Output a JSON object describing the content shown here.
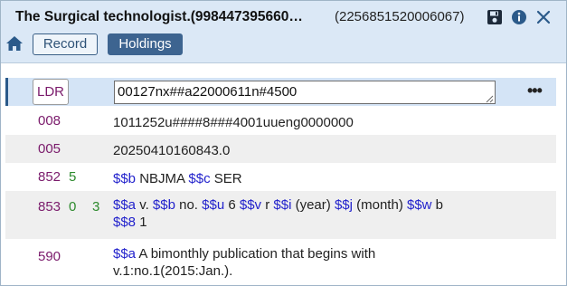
{
  "header": {
    "title": "The Surgical technologist.(998447395660…",
    "record_id": "(2256851520006067)"
  },
  "tabs": {
    "record_label": "Record",
    "holdings_label": "Holdings"
  },
  "icons": {
    "home": "home-icon",
    "save": "save-icon",
    "info": "info-icon",
    "close": "close-icon",
    "more": "more-options-icon"
  },
  "colors": {
    "header_bg": "#dbe8f6",
    "tag": "#7a1a6b",
    "indicator": "#2d8a2d",
    "subfield_code": "#2222cc",
    "active_tab": "#3d6490"
  },
  "fields": {
    "ldr": {
      "tag": "LDR",
      "value": "00127nx##a22000611n#4500",
      "more": "•••"
    },
    "f008": {
      "tag": "008",
      "content": "1011252u####8###4001uueng0000000"
    },
    "f005": {
      "tag": "005",
      "content": "20250410160843.0"
    },
    "f852": {
      "tag": "852",
      "ind1": "5",
      "ind2": "",
      "sf1_code": "$$b",
      "sf1_val": " NBJMA ",
      "sf2_code": "$$c",
      "sf2_val": " SER"
    },
    "f853": {
      "tag": "853",
      "ind1": "0",
      "ind2": "3",
      "a_code": "$$a",
      "a_val": " v. ",
      "b_code": "$$b",
      "b_val": " no. ",
      "u_code": "$$u",
      "u_val": " 6 ",
      "v_code": "$$v",
      "v_val": " r ",
      "i_code": "$$i",
      "i_val": " (year) ",
      "j_code": "$$j",
      "j_val": " (month) ",
      "w_code": "$$w",
      "w_val": " b",
      "s8_code": "$$8",
      "s8_val": " 1"
    },
    "f590": {
      "tag": "590",
      "a_code": "$$a",
      "a_val": " A bimonthly publication that begins with v.1:no.1(2015:Jan.)."
    }
  }
}
